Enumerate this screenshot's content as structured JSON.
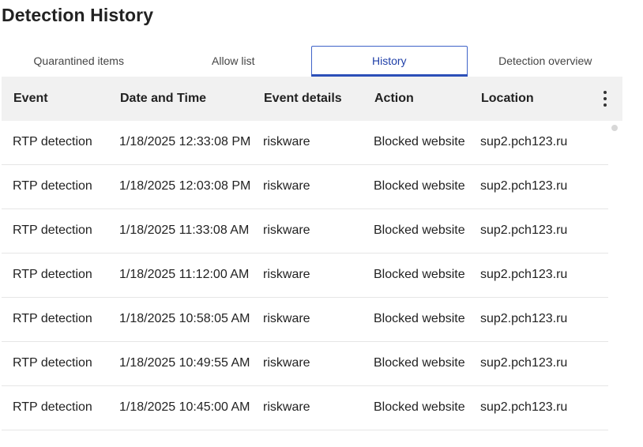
{
  "page": {
    "title": "Detection History"
  },
  "tabs": [
    {
      "label": "Quarantined items",
      "active": false
    },
    {
      "label": "Allow list",
      "active": false
    },
    {
      "label": "History",
      "active": true
    },
    {
      "label": "Detection overview",
      "active": false
    }
  ],
  "table": {
    "columns": [
      "Event",
      "Date and Time",
      "Event details",
      "Action",
      "Location"
    ],
    "rows": [
      {
        "event": "RTP detection",
        "datetime": "1/18/2025 12:33:08 PM",
        "details": "riskware",
        "action": "Blocked website",
        "location": "sup2.pch123.ru"
      },
      {
        "event": "RTP detection",
        "datetime": "1/18/2025 12:03:08 PM",
        "details": "riskware",
        "action": "Blocked website",
        "location": "sup2.pch123.ru"
      },
      {
        "event": "RTP detection",
        "datetime": "1/18/2025 11:33:08 AM",
        "details": "riskware",
        "action": "Blocked website",
        "location": "sup2.pch123.ru"
      },
      {
        "event": "RTP detection",
        "datetime": "1/18/2025 11:12:00 AM",
        "details": "riskware",
        "action": "Blocked website",
        "location": "sup2.pch123.ru"
      },
      {
        "event": "RTP detection",
        "datetime": "1/18/2025 10:58:05 AM",
        "details": "riskware",
        "action": "Blocked website",
        "location": "sup2.pch123.ru"
      },
      {
        "event": "RTP detection",
        "datetime": "1/18/2025 10:49:55 AM",
        "details": "riskware",
        "action": "Blocked website",
        "location": "sup2.pch123.ru"
      },
      {
        "event": "RTP detection",
        "datetime": "1/18/2025 10:45:00 AM",
        "details": "riskware",
        "action": "Blocked website",
        "location": "sup2.pch123.ru"
      }
    ]
  },
  "icons": {
    "menu": "more-vertical-icon"
  },
  "colors": {
    "accent": "#2c4fb8",
    "header_bg": "#f1f1f1"
  }
}
